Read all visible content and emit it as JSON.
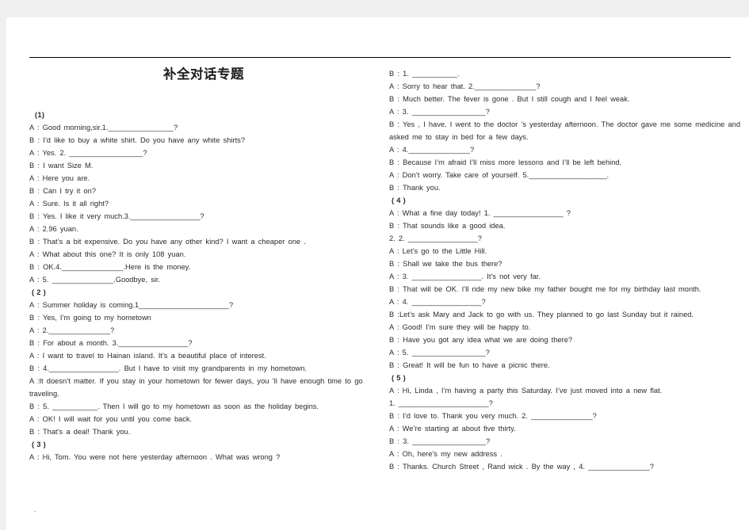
{
  "document": {
    "title": "补全对话专题",
    "trailing_mark": "."
  },
  "left_column": {
    "sections": [
      {
        "label": "(1)",
        "lines": [
          "A : Good  morning,sir.1.________________?",
          "B : I’d like to buy a white shirt. Do you have any white shirts?",
          "A : Yes. 2. __________________?",
          "B : I want Size M.",
          "A : Here you are.",
          "B : Can I try it on?",
          "A : Sure. Is it all right?",
          "B : Yes. I like it very much.3._________________?",
          "A : 2.96 yuan.",
          "B : That’s a bit expensive. Do you have any other kind? I want a cheaper one .",
          "A : What about this one? It is only 108 yuan.",
          "B : OK.4._______________.Here is the money.",
          "A : 5. _______________.Goodbye, sir."
        ]
      },
      {
        "label": "( 2 )",
        "lines": [
          "A : Summer holiday is coming.1______________________?",
          "B : Yes, I’m going to my hometown",
          "A : 2._______________?",
          "B : For about a month. 3._________________?",
          "A : I want to travel to Hainan island. It’s a beautiful place of interest.",
          "B : 4._________________. But I have to visit my grandparents in my hometown.",
          "A :It doesn’t matter. If you stay in your hometown for fewer days, you ’ll have enough time to go traveling.",
          "B : 5. ___________. Then I will go to my hometown as soon as the holiday begins.",
          "A : OK! I will wait for you until you come back.",
          "B : That’s a deal! Thank you."
        ]
      },
      {
        "label": "( 3 )",
        "lines": [
          "A : Hi, Tom. You were not here yesterday afternoon . What was wrong ?"
        ]
      }
    ]
  },
  "right_column": {
    "sections": [
      {
        "label": "",
        "lines": [
          "B : 1. ___________.",
          "A : Sorry to hear that. 2._______________?",
          "B : Much better. The fever is gone . But I still cough and I feel weak.",
          "A : 3. __________________?",
          "B : Yes , I have. I went to the doctor ’s yesterday afternoon. The doctor gave me some medicine and asked me to stay in bed for a few days.",
          "A : 4._______________?",
          "B : Because I’m afraid I’ll miss more lessons and I’ll be left behind.",
          "A : Don’t worry. Take care of yourself. 5.___________________.",
          "B : Thank you."
        ]
      },
      {
        "label": "( 4 )",
        "lines": [
          "A : What a fine day today! 1. _________________ ?",
          "B : That sounds like a good idea.",
          "2. 2. _________________?",
          "A : Let’s go to the Little Hill.",
          "B : Shall we take the bus there?",
          "A : 3. _________________. It’s not very far.",
          "B : That will be OK. I’ll ride my new bike my father bought me for my birthday last month.",
          "A : 4. _________________?",
          "B :Let’s ask Mary and Jack to go with us. They planned to go last Sunday but it rained.",
          "A : Good! I’m sure they will be happy to.",
          "B : Have you got any idea what we are doing there?",
          "A : 5. __________________?",
          "B : Great! It will be fun to have a picnic there."
        ]
      },
      {
        "label": "( 5 )",
        "lines": [
          "A : Hi, Linda , I’m having a party this Saturday. I’ve just moved into a new flat.",
          "1. ______________________?",
          "B : I’d love to. Thank you very much. 2. _______________?",
          "A : We’re starting at about five thirty.",
          "B : 3. __________________?",
          "A : Oh, here’s my new address .",
          "B : Thanks. Church Street , Rand wick . By the way , 4. _______________?"
        ]
      }
    ]
  }
}
